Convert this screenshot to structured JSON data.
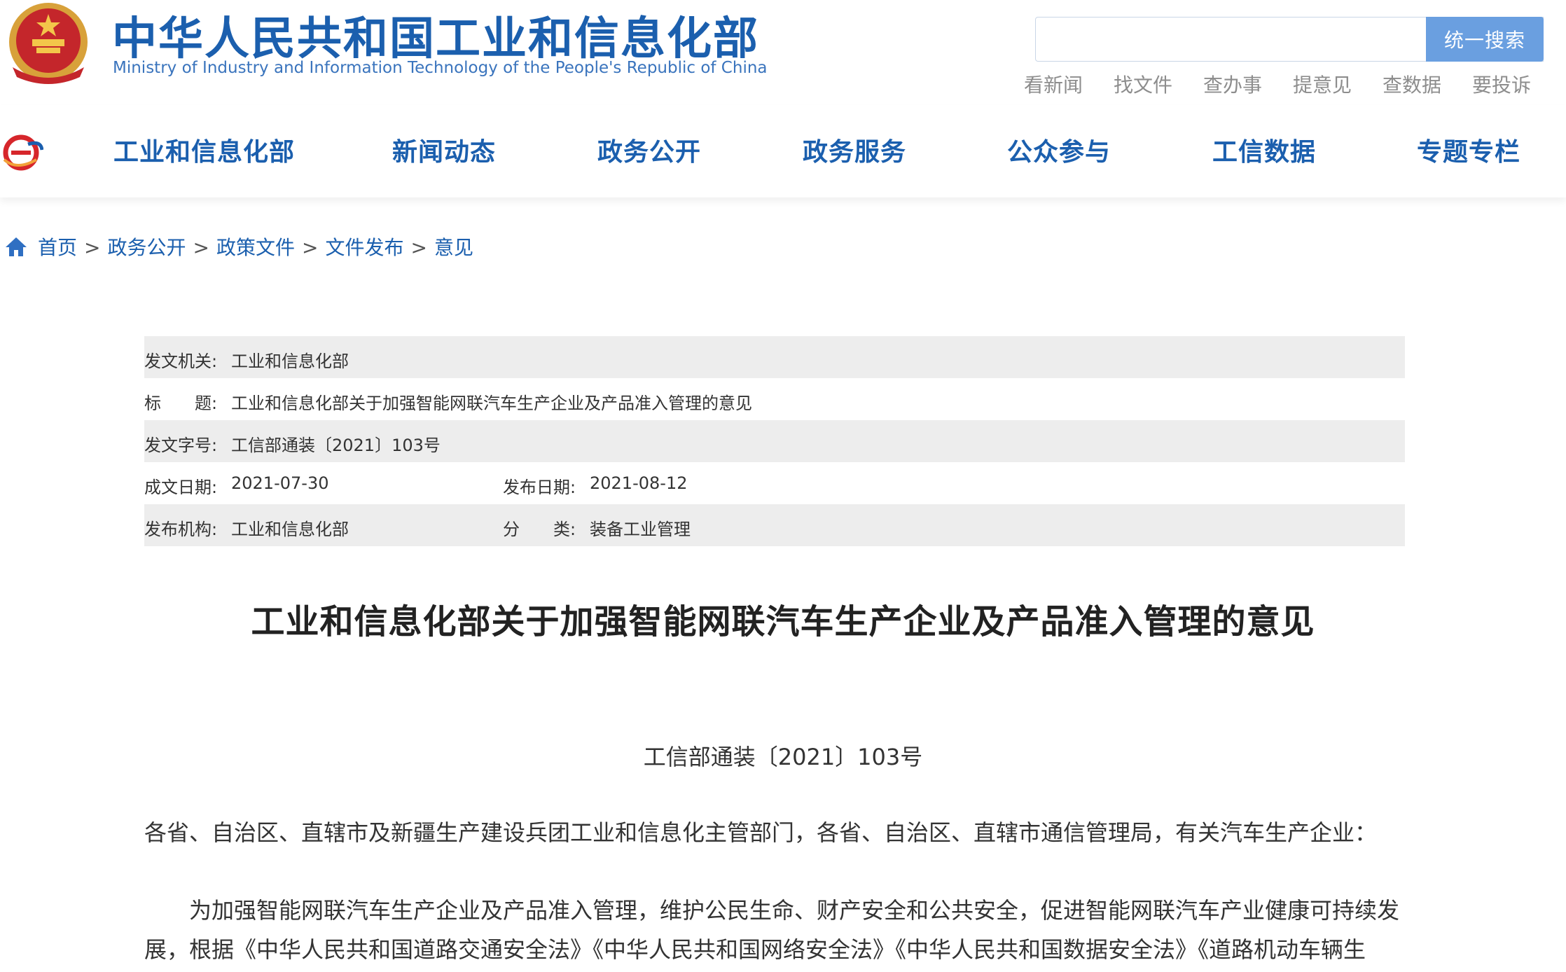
{
  "header": {
    "title": "中华人民共和国工业和信息化部",
    "subtitle": "Ministry of Industry and Information Technology of the People's Republic of China",
    "search": {
      "value": "",
      "button_label": "统一搜索"
    },
    "quick_links": [
      "看新闻",
      "找文件",
      "查办事",
      "提意见",
      "查数据",
      "要投诉"
    ]
  },
  "nav": {
    "items": [
      "工业和信息化部",
      "新闻动态",
      "政务公开",
      "政务服务",
      "公众参与",
      "工信数据",
      "专题专栏"
    ]
  },
  "breadcrumb": {
    "items": [
      "首页",
      "政务公开",
      "政策文件",
      "文件发布",
      "意见"
    ],
    "separator": ">"
  },
  "info": {
    "issuer_label": "发文机关:",
    "issuer": "工业和信息化部",
    "title_label": "标　　题:",
    "title": "工业和信息化部关于加强智能网联汽车生产企业及产品准入管理的意见",
    "doc_no_label": "发文字号:",
    "doc_no": "工信部通装〔2021〕103号",
    "written_date_label": "成文日期:",
    "written_date": "2021-07-30",
    "publish_date_label": "发布日期:",
    "publish_date": "2021-08-12",
    "publisher_label": "发布机构:",
    "publisher": "工业和信息化部",
    "category_label": "分　　类:",
    "category": "装备工业管理"
  },
  "document": {
    "title": "工业和信息化部关于加强智能网联汽车生产企业及产品准入管理的意见",
    "number": "工信部通装〔2021〕103号",
    "addressee": "各省、自治区、直辖市及新疆生产建设兵团工业和信息化主管部门，各省、自治区、直辖市通信管理局，有关汽车生产企业：",
    "para1_line1": "　　为加强智能网联汽车生产企业及产品准入管理，维护公民生命、财产安全和公共安全，促进智能网联汽车产业健康可持续发",
    "para1_line2": "展，根据《中华人民共和国道路交通安全法》《中华人民共和国网络安全法》《中华人民共和国数据安全法》《道路机动车辆生"
  },
  "colors": {
    "brand_blue": "#1b5fae",
    "search_button": "#6a9fe0",
    "row_shade": "#ededed"
  }
}
